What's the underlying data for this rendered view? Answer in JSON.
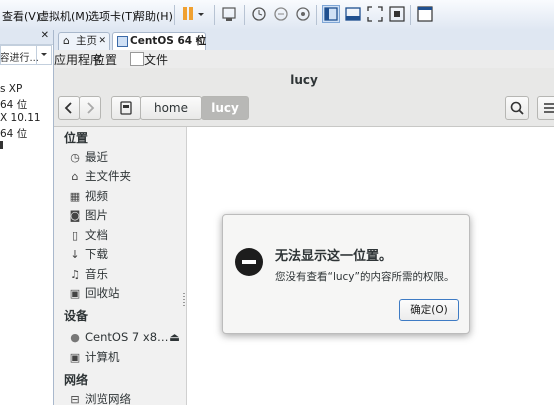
{
  "host": {
    "menu": [
      "查看(V)",
      "虚拟机(M)",
      "选项卡(T)",
      "帮助(H)"
    ],
    "library": {
      "close_glyph": "✕",
      "search_placeholder": "在此处键入内容进行...",
      "vms": [
        "s XP",
        "64 位",
        "X 10.11",
        "64 位"
      ]
    },
    "tabs": [
      {
        "label": "主页",
        "close": "✕"
      },
      {
        "label": "CentOS 64 位",
        "close": "✕"
      }
    ]
  },
  "guest": {
    "topbar": {
      "apps": "应用程序",
      "places": "位置",
      "files": "文件"
    }
  },
  "nautilus": {
    "window_title": "lucy",
    "path": [
      "home",
      "lucy"
    ],
    "sidebar": {
      "places_heading": "位置",
      "places": [
        {
          "icon": "clock-icon",
          "glyph": "◷",
          "label": "最近"
        },
        {
          "icon": "home-icon",
          "glyph": "⌂",
          "label": "主文件夹"
        },
        {
          "icon": "video-icon",
          "glyph": "▦",
          "label": "视频"
        },
        {
          "icon": "camera-icon",
          "glyph": "◙",
          "label": "图片"
        },
        {
          "icon": "document-icon",
          "glyph": "▯",
          "label": "文档"
        },
        {
          "icon": "download-icon",
          "glyph": "↓",
          "label": "下载"
        },
        {
          "icon": "music-icon",
          "glyph": "♫",
          "label": "音乐"
        },
        {
          "icon": "trash-icon",
          "glyph": "▣",
          "label": "回收站"
        }
      ],
      "devices_heading": "设备",
      "devices": [
        {
          "icon": "disc-icon",
          "glyph": "●",
          "label": "CentOS 7 x8…",
          "eject": "⏏"
        },
        {
          "icon": "computer-icon",
          "glyph": "▣",
          "label": "计算机"
        }
      ],
      "network_heading": "网络",
      "network": [
        {
          "icon": "network-icon",
          "glyph": "⊟",
          "label": "浏览网络"
        }
      ]
    }
  },
  "dialog": {
    "title": "无法显示这一位置。",
    "message": "您没有查看“lucy”的内容所需的权限。",
    "ok_label": "确定(O)"
  },
  "colors": {
    "accent": "#3e7bc4",
    "pause": "#f0a030",
    "dialog_icon": "#1d1d1d"
  }
}
